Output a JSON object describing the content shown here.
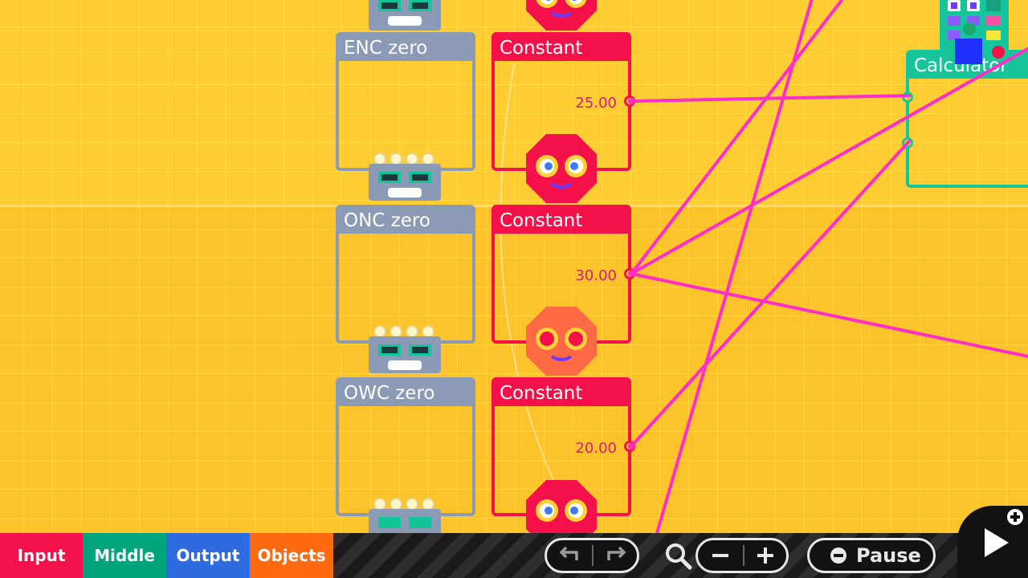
{
  "nodes": {
    "gray": [
      {
        "title": "ENC zero"
      },
      {
        "title": "ONC zero"
      },
      {
        "title": "OWC zero"
      }
    ],
    "constants": [
      {
        "title": "Constant",
        "value": "25.00"
      },
      {
        "title": "Constant",
        "value": "30.00"
      },
      {
        "title": "Constant",
        "value": "20.00"
      }
    ],
    "calculator": {
      "title": "Calculator"
    }
  },
  "bottom_bar": {
    "tabs": [
      {
        "label": "Input",
        "color": "#f4114a"
      },
      {
        "label": "Middle",
        "color": "#00a57e"
      },
      {
        "label": "Output",
        "color": "#2f6be0"
      },
      {
        "label": "Objects",
        "color": "#ff6a10"
      }
    ],
    "pause_label": "Pause"
  },
  "colors": {
    "background": "#fdc830",
    "wire": "#ff2ec8",
    "constant_node": "#f4114a",
    "gray_node": "#8b9bb6",
    "calculator_node": "#17c59a"
  },
  "icons": {
    "undo": "undo-icon",
    "redo": "redo-icon",
    "zoom": "magnifier-icon",
    "zoom_out": "minus-icon",
    "zoom_in": "plus-icon",
    "pause": "minus-circle-icon",
    "play": "play-icon",
    "add": "plus-circle-icon"
  }
}
